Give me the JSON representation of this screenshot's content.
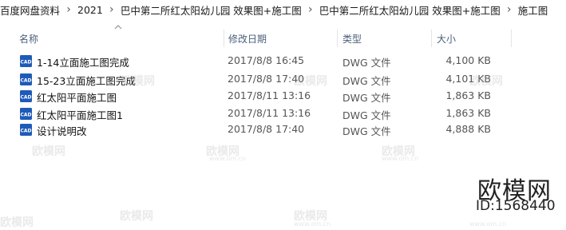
{
  "breadcrumb": [
    "百度网盘资料",
    "2021",
    "巴中第二所红太阳幼儿园 效果图+施工图",
    "巴中第二所红太阳幼儿园 效果图+施工图",
    "施工图"
  ],
  "columns": {
    "name": "名称",
    "date": "修改日期",
    "type": "类型",
    "size": "大小"
  },
  "files": [
    {
      "name": "1-14立面施工图完成",
      "date": "2017/8/8 16:45",
      "type": "DWG 文件",
      "size": "4,100 KB",
      "icon": "cad-file-icon"
    },
    {
      "name": "15-23立面施工图完成",
      "date": "2017/8/8 17:40",
      "type": "DWG 文件",
      "size": "4,101 KB",
      "icon": "cad-file-icon"
    },
    {
      "name": "红太阳平面施工图",
      "date": "2017/8/11 13:16",
      "type": "DWG 文件",
      "size": "1,863 KB",
      "icon": "cad-file-icon"
    },
    {
      "name": "红太阳平面施工图1",
      "date": "2017/8/11 13:16",
      "type": "DWG 文件",
      "size": "1,863 KB",
      "icon": "cad-file-icon"
    },
    {
      "name": "设计说明改",
      "date": "2017/8/8 17:40",
      "type": "DWG 文件",
      "size": "4,888 KB",
      "icon": "cad-file-icon"
    }
  ],
  "icon_label": "CAD",
  "watermark": {
    "text": "欧模网",
    "domain": "www.om.cn",
    "brand": "欧模网",
    "id": "ID:1568440"
  }
}
